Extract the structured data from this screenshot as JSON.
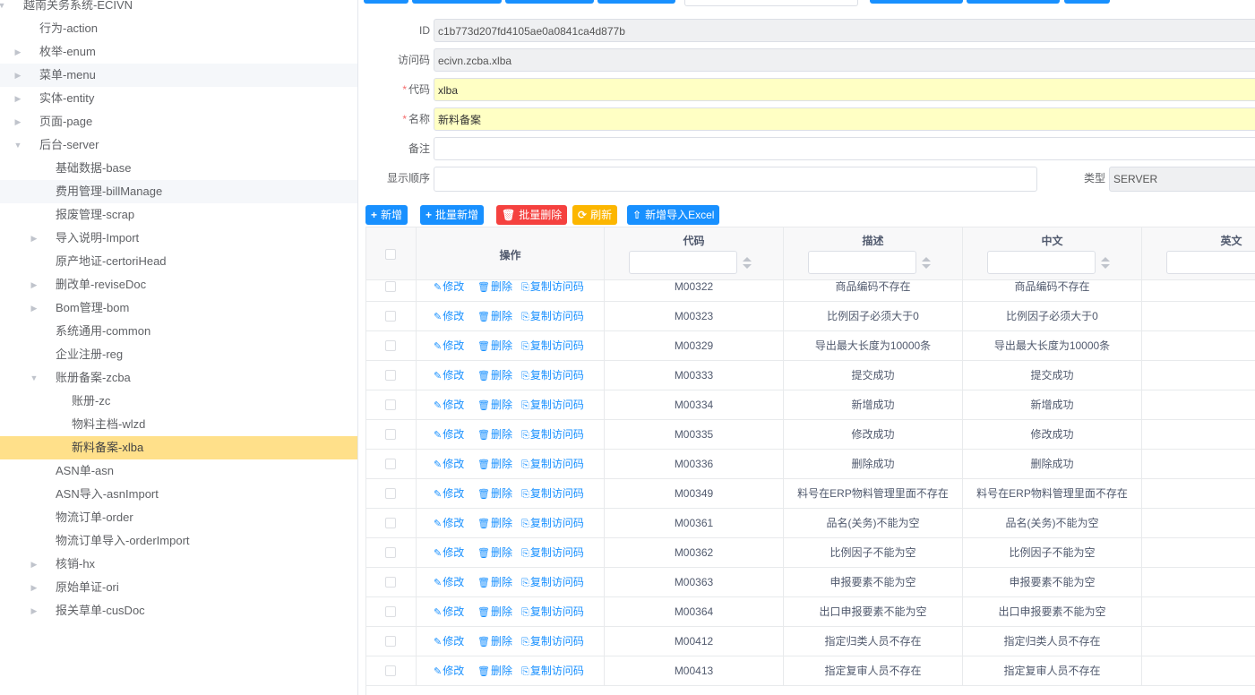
{
  "sidebar": {
    "nodes": [
      {
        "label": "越南关务系统-ECIVN",
        "level": 0,
        "arrow": "down",
        "state": ""
      },
      {
        "label": "行为-action",
        "level": 1,
        "arrow": "none",
        "state": ""
      },
      {
        "label": "枚举-enum",
        "level": 1,
        "arrow": "right",
        "state": ""
      },
      {
        "label": "菜单-menu",
        "level": 1,
        "arrow": "right",
        "state": "hover"
      },
      {
        "label": "实体-entity",
        "level": 1,
        "arrow": "right",
        "state": ""
      },
      {
        "label": "页面-page",
        "level": 1,
        "arrow": "right",
        "state": ""
      },
      {
        "label": "后台-server",
        "level": 1,
        "arrow": "down",
        "state": ""
      },
      {
        "label": "基础数据-base",
        "level": 2,
        "arrow": "none",
        "state": ""
      },
      {
        "label": "费用管理-billManage",
        "level": 2,
        "arrow": "none",
        "state": "hover"
      },
      {
        "label": "报废管理-scrap",
        "level": 2,
        "arrow": "none",
        "state": ""
      },
      {
        "label": "导入说明-Import",
        "level": 2,
        "arrow": "right",
        "state": ""
      },
      {
        "label": "原产地证-certoriHead",
        "level": 2,
        "arrow": "none",
        "state": ""
      },
      {
        "label": "删改单-reviseDoc",
        "level": 2,
        "arrow": "right",
        "state": ""
      },
      {
        "label": "Bom管理-bom",
        "level": 2,
        "arrow": "right",
        "state": ""
      },
      {
        "label": "系统通用-common",
        "level": 2,
        "arrow": "none",
        "state": ""
      },
      {
        "label": "企业注册-reg",
        "level": 2,
        "arrow": "none",
        "state": ""
      },
      {
        "label": "账册备案-zcba",
        "level": 2,
        "arrow": "down",
        "state": ""
      },
      {
        "label": "账册-zc",
        "level": 3,
        "arrow": "none",
        "state": ""
      },
      {
        "label": "物料主档-wlzd",
        "level": 3,
        "arrow": "none",
        "state": ""
      },
      {
        "label": "新料备案-xlba",
        "level": 3,
        "arrow": "none",
        "state": "active"
      },
      {
        "label": "ASN单-asn",
        "level": 2,
        "arrow": "none",
        "state": ""
      },
      {
        "label": "ASN导入-asnImport",
        "level": 2,
        "arrow": "none",
        "state": ""
      },
      {
        "label": "物流订单-order",
        "level": 2,
        "arrow": "none",
        "state": ""
      },
      {
        "label": "物流订单导入-orderImport",
        "level": 2,
        "arrow": "none",
        "state": ""
      },
      {
        "label": "核销-hx",
        "level": 2,
        "arrow": "right",
        "state": ""
      },
      {
        "label": "原始单证-ori",
        "level": 2,
        "arrow": "right",
        "state": ""
      },
      {
        "label": "报关草单-cusDoc",
        "level": 2,
        "arrow": "right",
        "state": ""
      }
    ]
  },
  "form": {
    "id_label": "ID",
    "id_value": "c1b773d207fd4105ae0a0841ca4d877b",
    "access_label": "访问码",
    "access_value": "ecivn.zcba.xlba",
    "code_label": "代码",
    "code_value": "xlba",
    "name_label": "名称",
    "name_value": "新料备案",
    "remark_label": "备注",
    "remark_value": "",
    "order_label": "显示顺序",
    "order_value": "",
    "type_label": "类型",
    "type_value": "SERVER",
    "required_mark": "*"
  },
  "toolbar": {
    "add": "新增",
    "batch_add": "批量新增",
    "batch_delete": "批量删除",
    "refresh": "刷新",
    "import_excel": "新增导入Excel"
  },
  "table": {
    "headers": {
      "op": "操作",
      "code": "代码",
      "desc": "描述",
      "zh": "中文",
      "en": "英文"
    },
    "actions": {
      "edit": "修改",
      "delete": "删除",
      "copy": "复制访问码"
    },
    "rows": [
      {
        "code": "M00322",
        "desc": "商品编码不存在",
        "zh": "商品编码不存在"
      },
      {
        "code": "M00323",
        "desc": "比例因子必须大于0",
        "zh": "比例因子必须大于0"
      },
      {
        "code": "M00329",
        "desc": "导出最大长度为10000条",
        "zh": "导出最大长度为10000条"
      },
      {
        "code": "M00333",
        "desc": "提交成功",
        "zh": "提交成功"
      },
      {
        "code": "M00334",
        "desc": "新增成功",
        "zh": "新增成功"
      },
      {
        "code": "M00335",
        "desc": "修改成功",
        "zh": "修改成功"
      },
      {
        "code": "M00336",
        "desc": "删除成功",
        "zh": "删除成功"
      },
      {
        "code": "M00349",
        "desc": "料号在ERP物料管理里面不存在",
        "zh": "料号在ERP物料管理里面不存在"
      },
      {
        "code": "M00361",
        "desc": "品名(关务)不能为空",
        "zh": "品名(关务)不能为空"
      },
      {
        "code": "M00362",
        "desc": "比例因子不能为空",
        "zh": "比例因子不能为空"
      },
      {
        "code": "M00363",
        "desc": "申报要素不能为空",
        "zh": "申报要素不能为空"
      },
      {
        "code": "M00364",
        "desc": "出口申报要素不能为空",
        "zh": "出口申报要素不能为空"
      },
      {
        "code": "M00412",
        "desc": "指定归类人员不存在",
        "zh": "指定归类人员不存在"
      },
      {
        "code": "M00413",
        "desc": "指定复审人员不存在",
        "zh": "指定复审人员不存在"
      }
    ]
  },
  "colors": {
    "primary": "#1890ff",
    "danger": "#f5413f",
    "warning": "#fcb600",
    "active": "#ffe08a",
    "required_bg": "#ffffc4"
  }
}
